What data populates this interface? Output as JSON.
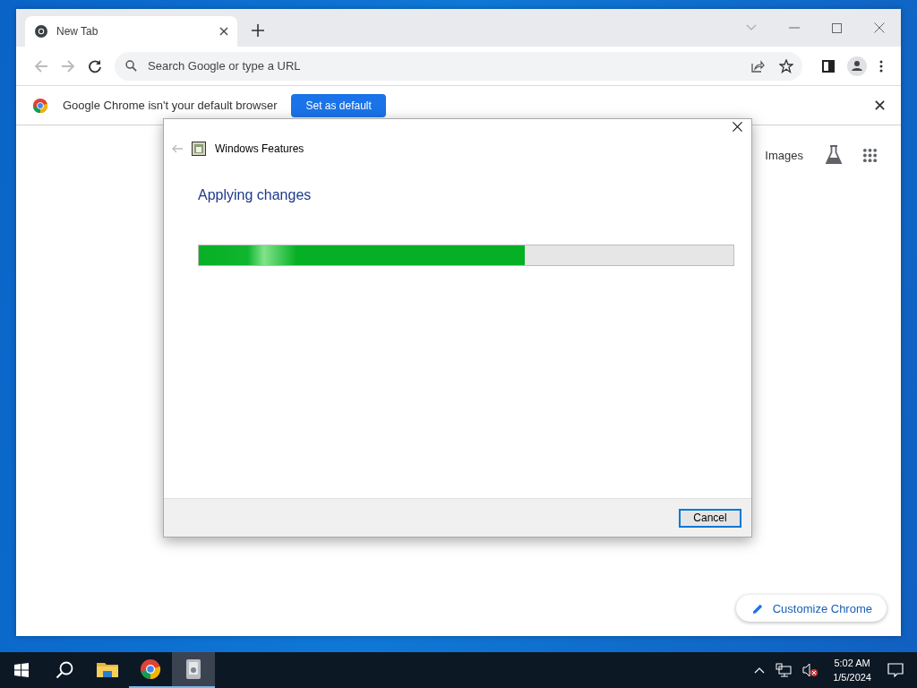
{
  "browser": {
    "tabs": [
      {
        "title": "New Tab",
        "selected": true
      }
    ],
    "omnibox": {
      "placeholder": "Search Google or type a URL"
    },
    "infobar": {
      "message": "Google Chrome isn't your default browser",
      "button": "Set as default"
    },
    "ntp": {
      "images_link": "Images",
      "customize_button": "Customize Chrome"
    }
  },
  "dialog": {
    "title": "Windows Features",
    "heading": "Applying changes",
    "progress": {
      "level": 0.61
    },
    "cancel_button": "Cancel"
  },
  "taskbar": {
    "apps": [
      {
        "kind": "explorer",
        "running": false,
        "selected": false
      },
      {
        "kind": "chrome",
        "running": true,
        "selected": false
      },
      {
        "kind": "features",
        "running": true,
        "selected": true
      }
    ],
    "clock": {
      "time": "5:02 AM",
      "date": "1/5/2024"
    }
  }
}
